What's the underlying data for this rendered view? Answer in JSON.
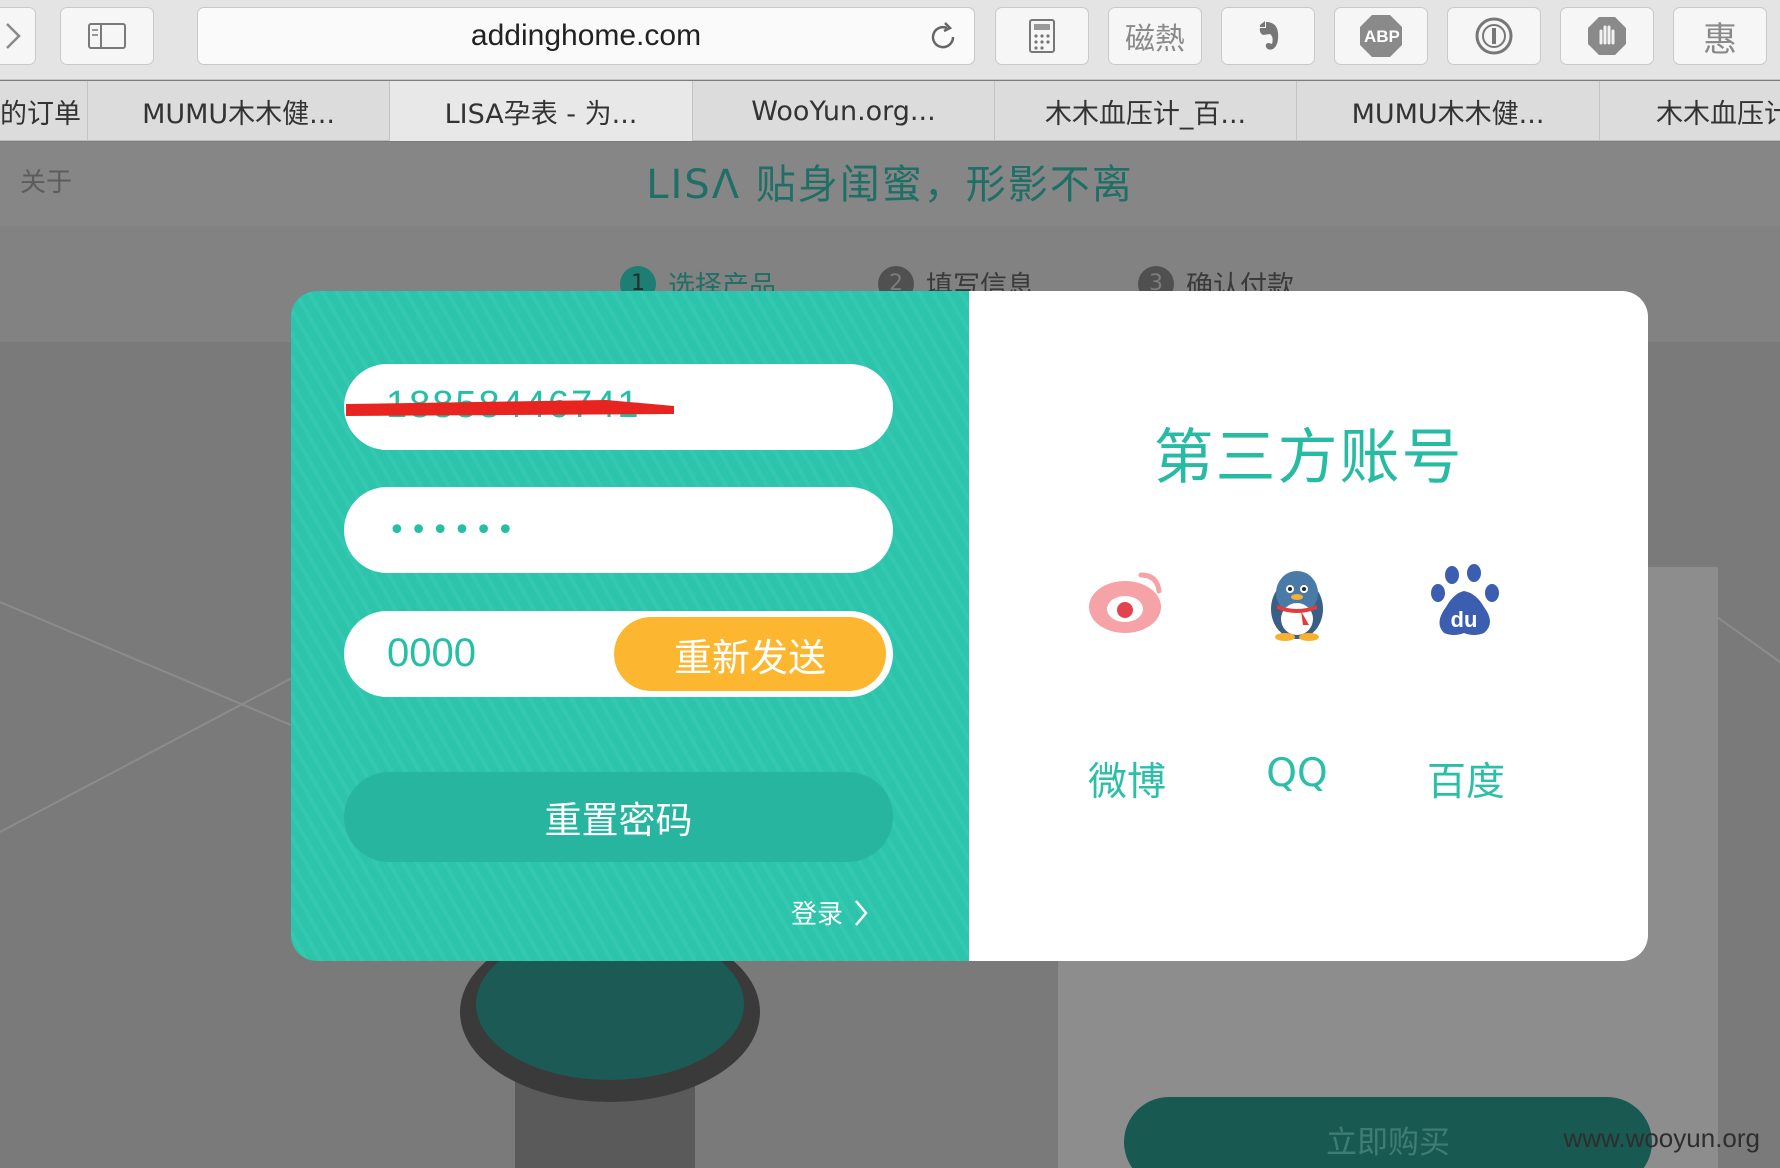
{
  "browser": {
    "url": "addinghome.com",
    "toolbar_icons": [
      "chevron-right-icon",
      "sidebar-icon",
      "reload-icon",
      "calculator-icon",
      "stamp-icon",
      "evernote-icon",
      "adblock-icon",
      "password-icon",
      "stop-hand-icon",
      "hui-icon"
    ],
    "stamp_icon_label": "磁熱",
    "adblock_label": "ABP",
    "hui_label": "惠",
    "tabs": [
      {
        "label": "我的订单"
      },
      {
        "label": "MUMU木木健..."
      },
      {
        "label": "LISA孕表 - 为..."
      },
      {
        "label": "WooYun.org..."
      },
      {
        "label": "木木血压计_百..."
      },
      {
        "label": "MUMU木木健..."
      },
      {
        "label": "木木血压计"
      }
    ]
  },
  "page": {
    "about_link": "关于",
    "slogan": "LISΛ 贴身闺蜜，形影不离",
    "steps": [
      {
        "num": "1",
        "label": "选择产品"
      },
      {
        "num": "2",
        "label": "填写信息"
      },
      {
        "num": "3",
        "label": "确认付款"
      }
    ],
    "buy_button": "立即购买",
    "watermark": "www.wooyun.org"
  },
  "modal": {
    "phone_value": "18858446741",
    "phone_redacted": true,
    "password_mask": "••••••",
    "code_value": "0000",
    "resend_button": "重新发送",
    "reset_button": "重置密码",
    "login_link": "登录",
    "third_party_title": "第三方账号",
    "social": [
      {
        "icon": "weibo-icon",
        "label": "微博"
      },
      {
        "icon": "qq-icon",
        "label": "QQ"
      },
      {
        "icon": "baidu-icon",
        "label": "百度"
      }
    ],
    "colors": {
      "teal": "#2cc5ac",
      "orange": "#fdb62f",
      "white": "#ffffff"
    }
  }
}
